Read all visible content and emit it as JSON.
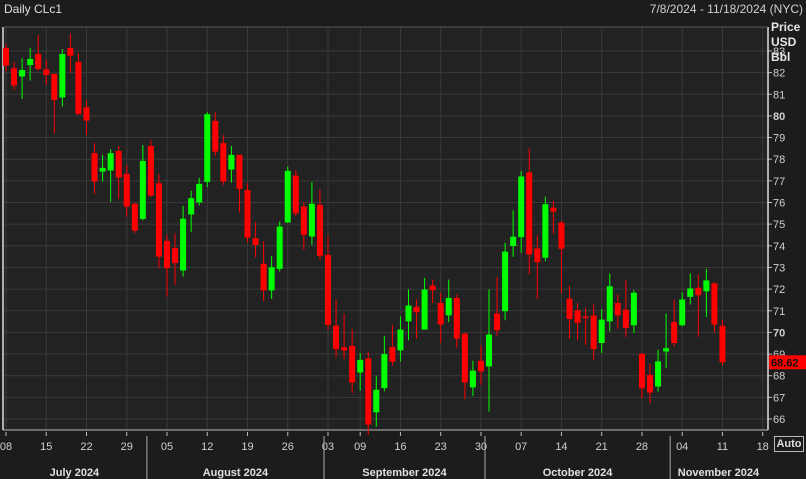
{
  "header": {
    "title": "Daily CLc1",
    "date_range": "7/8/2024 - 11/18/2024 (NYC)"
  },
  "axis_units": [
    "Price",
    "USD",
    "Bbl"
  ],
  "auto_button": "Auto",
  "colors": {
    "up": "#00ff00",
    "down": "#ff0000",
    "background": "#222222",
    "grid": "#3a3a3a"
  },
  "chart_data": {
    "type": "candlestick",
    "title": "Daily CLc1",
    "ylabel": "Price USD Bbl",
    "ylim": [
      65,
      84
    ],
    "yticks": [
      66,
      67,
      68,
      69,
      70,
      71,
      72,
      73,
      74,
      75,
      76,
      77,
      78,
      79,
      80,
      81,
      82,
      83
    ],
    "bold_yticks": [
      70,
      80
    ],
    "last_price": "68.62",
    "grid": true,
    "xticks": [
      {
        "date": "2024-07-08",
        "label": "08"
      },
      {
        "date": "2024-07-15",
        "label": "15"
      },
      {
        "date": "2024-07-22",
        "label": "22"
      },
      {
        "date": "2024-07-29",
        "label": "29"
      },
      {
        "date": "2024-08-05",
        "label": "05"
      },
      {
        "date": "2024-08-12",
        "label": "12"
      },
      {
        "date": "2024-08-19",
        "label": "19"
      },
      {
        "date": "2024-08-26",
        "label": "26"
      },
      {
        "date": "2024-09-03",
        "label": "03"
      },
      {
        "date": "2024-09-09",
        "label": "09"
      },
      {
        "date": "2024-09-16",
        "label": "16"
      },
      {
        "date": "2024-09-23",
        "label": "23"
      },
      {
        "date": "2024-09-30",
        "label": "30"
      },
      {
        "date": "2024-10-07",
        "label": "07"
      },
      {
        "date": "2024-10-14",
        "label": "14"
      },
      {
        "date": "2024-10-21",
        "label": "21"
      },
      {
        "date": "2024-10-28",
        "label": "28"
      },
      {
        "date": "2024-11-04",
        "label": "04"
      },
      {
        "date": "2024-11-11",
        "label": "11"
      },
      {
        "date": "2024-11-18",
        "label": "18"
      }
    ],
    "months": [
      {
        "label": "July 2024",
        "start": "2024-07-08",
        "end": "2024-07-31"
      },
      {
        "label": "August 2024",
        "start": "2024-08-01",
        "end": "2024-08-30"
      },
      {
        "label": "September 2024",
        "start": "2024-09-03",
        "end": "2024-09-30"
      },
      {
        "label": "October 2024",
        "start": "2024-10-01",
        "end": "2024-10-31"
      },
      {
        "label": "November 2024",
        "start": "2024-11-01",
        "end": "2024-11-18"
      }
    ],
    "ohlc_columns": [
      "date",
      "open",
      "high",
      "low",
      "close"
    ],
    "ohlc": [
      [
        "2024-07-08",
        83.14,
        83.32,
        82.05,
        82.32
      ],
      [
        "2024-07-09",
        82.2,
        82.48,
        81.2,
        81.4
      ],
      [
        "2024-07-10",
        81.82,
        82.66,
        80.78,
        82.12
      ],
      [
        "2024-07-11",
        82.35,
        83.14,
        81.63,
        82.63
      ],
      [
        "2024-07-12",
        82.86,
        83.74,
        82.09,
        82.17
      ],
      [
        "2024-07-15",
        82.15,
        82.58,
        81.43,
        81.89
      ],
      [
        "2024-07-16",
        81.94,
        81.94,
        79.2,
        80.74
      ],
      [
        "2024-07-17",
        80.85,
        83.09,
        80.43,
        82.86
      ],
      [
        "2024-07-18",
        83.14,
        83.81,
        82.0,
        82.78
      ],
      [
        "2024-07-19",
        82.49,
        82.89,
        80.05,
        80.09
      ],
      [
        "2024-07-22",
        80.4,
        80.71,
        79.12,
        79.78
      ],
      [
        "2024-07-23",
        78.28,
        78.74,
        76.4,
        76.97
      ],
      [
        "2024-07-24",
        77.43,
        78.2,
        76.97,
        77.6
      ],
      [
        "2024-07-25",
        77.48,
        78.47,
        76.04,
        78.28
      ],
      [
        "2024-07-26",
        78.38,
        78.61,
        76.17,
        77.15
      ],
      [
        "2024-07-29",
        77.32,
        77.74,
        75.35,
        75.81
      ],
      [
        "2024-07-30",
        75.94,
        76.0,
        74.58,
        74.7
      ],
      [
        "2024-07-31",
        75.24,
        78.66,
        75.17,
        77.92
      ],
      [
        "2024-08-01",
        78.61,
        78.89,
        76.24,
        76.32
      ],
      [
        "2024-08-02",
        76.89,
        77.32,
        72.97,
        73.5
      ],
      [
        "2024-08-05",
        74.23,
        74.5,
        71.66,
        72.97
      ],
      [
        "2024-08-06",
        73.89,
        74.58,
        72.2,
        73.2
      ],
      [
        "2024-08-07",
        72.86,
        75.85,
        72.58,
        75.25
      ],
      [
        "2024-08-08",
        75.45,
        76.54,
        74.63,
        76.2
      ],
      [
        "2024-08-09",
        76.0,
        77.14,
        75.86,
        76.86
      ],
      [
        "2024-08-12",
        76.95,
        80.17,
        76.71,
        80.08
      ],
      [
        "2024-08-13",
        79.77,
        80.17,
        78.15,
        78.35
      ],
      [
        "2024-08-14",
        78.74,
        79.12,
        76.81,
        76.97
      ],
      [
        "2024-08-15",
        77.52,
        78.61,
        76.92,
        78.2
      ],
      [
        "2024-08-16",
        78.2,
        78.2,
        75.54,
        76.63
      ],
      [
        "2024-08-19",
        76.58,
        76.89,
        74.15,
        74.38
      ],
      [
        "2024-08-20",
        74.35,
        75.08,
        73.47,
        74.04
      ],
      [
        "2024-08-21",
        73.17,
        74.2,
        71.45,
        71.94
      ],
      [
        "2024-08-22",
        71.94,
        73.53,
        71.54,
        73.01
      ],
      [
        "2024-08-23",
        72.93,
        75.12,
        72.81,
        74.89
      ],
      [
        "2024-08-26",
        75.08,
        77.66,
        75.05,
        77.46
      ],
      [
        "2024-08-27",
        77.24,
        77.5,
        75.38,
        75.5
      ],
      [
        "2024-08-28",
        75.81,
        76.0,
        73.81,
        74.51
      ],
      [
        "2024-08-29",
        74.43,
        76.94,
        74.04,
        75.94
      ],
      [
        "2024-08-30",
        75.89,
        76.61,
        73.35,
        73.54
      ],
      [
        "2024-09-03",
        73.58,
        74.46,
        70.12,
        70.35
      ],
      [
        "2024-09-04",
        70.31,
        71.51,
        68.86,
        69.23
      ],
      [
        "2024-09-05",
        69.31,
        70.86,
        68.77,
        69.17
      ],
      [
        "2024-09-06",
        69.38,
        70.15,
        67.2,
        67.69
      ],
      [
        "2024-09-09",
        68.15,
        69.04,
        67.31,
        68.73
      ],
      [
        "2024-09-10",
        68.8,
        69.12,
        65.28,
        65.74
      ],
      [
        "2024-09-11",
        66.31,
        67.99,
        65.65,
        67.35
      ],
      [
        "2024-09-12",
        67.43,
        69.84,
        67.28,
        69.0
      ],
      [
        "2024-09-13",
        69.32,
        70.35,
        68.48,
        68.65
      ],
      [
        "2024-09-16",
        69.17,
        70.74,
        68.66,
        70.13
      ],
      [
        "2024-09-17",
        70.51,
        71.98,
        69.63,
        71.24
      ],
      [
        "2024-09-18",
        71.18,
        71.52,
        69.71,
        70.93
      ],
      [
        "2024-09-19",
        70.13,
        72.52,
        70.16,
        71.98
      ],
      [
        "2024-09-20",
        72.16,
        72.44,
        71.36,
        71.95
      ],
      [
        "2024-09-23",
        71.36,
        71.83,
        69.51,
        70.36
      ],
      [
        "2024-09-24",
        70.79,
        72.44,
        70.47,
        71.59
      ],
      [
        "2024-09-25",
        71.59,
        71.75,
        69.28,
        69.71
      ],
      [
        "2024-09-26",
        69.94,
        70.0,
        66.91,
        67.69
      ],
      [
        "2024-09-27",
        67.46,
        68.69,
        67.07,
        68.23
      ],
      [
        "2024-09-30",
        68.69,
        69.4,
        67.58,
        68.2
      ],
      [
        "2024-10-01",
        68.43,
        71.98,
        66.34,
        69.9
      ],
      [
        "2024-10-02",
        70.87,
        72.55,
        69.85,
        70.1
      ],
      [
        "2024-10-03",
        70.98,
        74.14,
        70.56,
        73.73
      ],
      [
        "2024-10-04",
        73.99,
        75.64,
        73.49,
        74.42
      ],
      [
        "2024-10-07",
        74.4,
        77.46,
        73.68,
        77.2
      ],
      [
        "2024-10-08",
        77.39,
        78.5,
        72.68,
        73.6
      ],
      [
        "2024-10-09",
        73.88,
        74.48,
        71.55,
        73.25
      ],
      [
        "2024-10-10",
        73.45,
        76.27,
        73.29,
        75.92
      ],
      [
        "2024-10-11",
        75.76,
        76.07,
        74.56,
        75.58
      ],
      [
        "2024-10-14",
        75.07,
        75.15,
        71.8,
        73.86
      ],
      [
        "2024-10-15",
        71.55,
        72.16,
        69.71,
        70.62
      ],
      [
        "2024-10-16",
        71.02,
        71.36,
        69.63,
        70.44
      ],
      [
        "2024-10-17",
        70.73,
        71.13,
        69.43,
        70.7
      ],
      [
        "2024-10-18",
        70.78,
        71.29,
        68.71,
        69.23
      ],
      [
        "2024-10-21",
        69.51,
        71.08,
        69.05,
        70.59
      ],
      [
        "2024-10-22",
        70.51,
        72.72,
        70.05,
        72.13
      ],
      [
        "2024-10-23",
        71.36,
        71.75,
        70.16,
        70.79
      ],
      [
        "2024-10-24",
        71.05,
        72.4,
        69.79,
        70.2
      ],
      [
        "2024-10-25",
        70.33,
        71.95,
        69.97,
        71.83
      ],
      [
        "2024-10-28",
        69.01,
        69.05,
        66.96,
        67.42
      ],
      [
        "2024-10-29",
        68.04,
        68.55,
        66.73,
        67.22
      ],
      [
        "2024-10-30",
        67.5,
        69.2,
        67.27,
        68.66
      ],
      [
        "2024-10-31",
        69.12,
        70.87,
        68.35,
        69.27
      ],
      [
        "2024-11-01",
        70.48,
        71.52,
        69.35,
        69.51
      ],
      [
        "2024-11-04",
        70.33,
        71.86,
        70.28,
        71.52
      ],
      [
        "2024-11-05",
        71.64,
        72.72,
        71.29,
        72.03
      ],
      [
        "2024-11-06",
        72.06,
        72.68,
        69.79,
        71.72
      ],
      [
        "2024-11-07",
        71.9,
        72.94,
        70.71,
        72.4
      ],
      [
        "2024-11-08",
        72.26,
        72.32,
        70.0,
        70.36
      ],
      [
        "2024-11-11",
        70.31,
        70.59,
        68.46,
        68.62
      ]
    ]
  }
}
